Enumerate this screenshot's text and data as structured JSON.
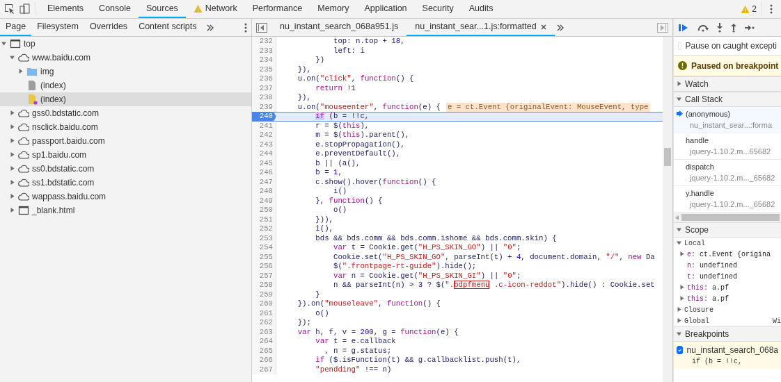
{
  "toolbar": {
    "tabs": [
      {
        "label": "Elements",
        "selected": false,
        "warning": false
      },
      {
        "label": "Console",
        "selected": false,
        "warning": false
      },
      {
        "label": "Sources",
        "selected": true,
        "warning": false
      },
      {
        "label": "Network",
        "selected": false,
        "warning": true
      },
      {
        "label": "Performance",
        "selected": false,
        "warning": false
      },
      {
        "label": "Memory",
        "selected": false,
        "warning": false
      },
      {
        "label": "Application",
        "selected": false,
        "warning": false
      },
      {
        "label": "Security",
        "selected": false,
        "warning": false
      },
      {
        "label": "Audits",
        "selected": false,
        "warning": false
      }
    ],
    "warning_count": "2"
  },
  "navigator": {
    "tabs": [
      {
        "label": "Page",
        "selected": true
      },
      {
        "label": "Filesystem",
        "selected": false
      },
      {
        "label": "Overrides",
        "selected": false
      },
      {
        "label": "Content scripts",
        "selected": false
      }
    ],
    "tree": [
      {
        "label": "top",
        "kind": "frame",
        "expanded": true,
        "selected": false,
        "children": [
          {
            "label": "www.baidu.com",
            "kind": "domain",
            "expanded": true,
            "selected": false,
            "children": [
              {
                "label": "img",
                "kind": "folder",
                "expanded": false,
                "selected": false
              },
              {
                "label": "(index)",
                "kind": "file",
                "selected": false
              },
              {
                "label": "(index)",
                "kind": "script",
                "selected": true
              }
            ]
          },
          {
            "label": "gss0.bdstatic.com",
            "kind": "domain",
            "expanded": false,
            "selected": false
          },
          {
            "label": "nsclick.baidu.com",
            "kind": "domain",
            "expanded": false,
            "selected": false
          },
          {
            "label": "passport.baidu.com",
            "kind": "domain",
            "expanded": false,
            "selected": false
          },
          {
            "label": "sp1.baidu.com",
            "kind": "domain",
            "expanded": false,
            "selected": false
          },
          {
            "label": "ss0.bdstatic.com",
            "kind": "domain",
            "expanded": false,
            "selected": false
          },
          {
            "label": "ss1.bdstatic.com",
            "kind": "domain",
            "expanded": false,
            "selected": false
          },
          {
            "label": "wappass.baidu.com",
            "kind": "domain",
            "expanded": false,
            "selected": false
          },
          {
            "label": "_blank.html",
            "kind": "frame",
            "expanded": false,
            "selected": false
          }
        ]
      }
    ]
  },
  "editor": {
    "tabs": [
      {
        "label": "nu_instant_search_068a951.js",
        "selected": false,
        "closable": false
      },
      {
        "label": "nu_instant_sear...1.js:formatted",
        "selected": true,
        "closable": true
      }
    ],
    "lines": [
      {
        "number": "232",
        "segments": [
          {
            "kind": "txt",
            "text": "            top: n.top + "
          },
          {
            "kind": "num",
            "text": "18"
          },
          {
            "kind": "txt",
            "text": ","
          }
        ]
      },
      {
        "number": "233",
        "segments": [
          {
            "kind": "txt",
            "text": "            left: i"
          }
        ]
      },
      {
        "number": "234",
        "segments": [
          {
            "kind": "txt",
            "text": "        })"
          }
        ]
      },
      {
        "number": "235",
        "segments": [
          {
            "kind": "txt",
            "text": "    }),"
          }
        ]
      },
      {
        "number": "236",
        "segments": [
          {
            "kind": "txt",
            "text": "    u.on("
          },
          {
            "kind": "str",
            "text": "\"click\""
          },
          {
            "kind": "txt",
            "text": ", "
          },
          {
            "kind": "kw",
            "text": "function"
          },
          {
            "kind": "txt",
            "text": "() {"
          }
        ]
      },
      {
        "number": "237",
        "segments": [
          {
            "kind": "kw",
            "text": "        return"
          },
          {
            "kind": "txt",
            "text": " !1"
          }
        ]
      },
      {
        "number": "238",
        "segments": [
          {
            "kind": "txt",
            "text": "    }),"
          }
        ]
      },
      {
        "number": "239",
        "segments": [
          {
            "kind": "txt",
            "text": "    u.on("
          },
          {
            "kind": "str",
            "text": "\"mouseenter\""
          },
          {
            "kind": "txt",
            "text": ", "
          },
          {
            "kind": "kw",
            "text": "function"
          },
          {
            "kind": "txt",
            "text": "(e) {"
          }
        ],
        "inline_value": "e = ct.Event {originalEvent: MouseEvent, type"
      },
      {
        "number": "240",
        "breakpoint": true,
        "current": true,
        "segments": [
          {
            "kind": "hl",
            "text": "if"
          },
          {
            "kind": "txt",
            "text": " (b = !!c,"
          }
        ]
      },
      {
        "number": "241",
        "segments": [
          {
            "kind": "txt",
            "text": "        r = $("
          },
          {
            "kind": "kw",
            "text": "this"
          },
          {
            "kind": "txt",
            "text": "),"
          }
        ]
      },
      {
        "number": "242",
        "segments": [
          {
            "kind": "txt",
            "text": "        m = $("
          },
          {
            "kind": "kw",
            "text": "this"
          },
          {
            "kind": "txt",
            "text": ").parent(),"
          }
        ]
      },
      {
        "number": "243",
        "segments": [
          {
            "kind": "txt",
            "text": "        e.stopPropagation(),"
          }
        ]
      },
      {
        "number": "244",
        "segments": [
          {
            "kind": "txt",
            "text": "        e.preventDefault(),"
          }
        ]
      },
      {
        "number": "245",
        "segments": [
          {
            "kind": "txt",
            "text": "        b || (a(),"
          }
        ]
      },
      {
        "number": "246",
        "segments": [
          {
            "kind": "txt",
            "text": "        b = "
          },
          {
            "kind": "num",
            "text": "1"
          },
          {
            "kind": "txt",
            "text": ","
          }
        ]
      },
      {
        "number": "247",
        "segments": [
          {
            "kind": "txt",
            "text": "        c.show().hover("
          },
          {
            "kind": "kw",
            "text": "function"
          },
          {
            "kind": "txt",
            "text": "() {"
          }
        ]
      },
      {
        "number": "248",
        "segments": [
          {
            "kind": "txt",
            "text": "            i()"
          }
        ]
      },
      {
        "number": "249",
        "segments": [
          {
            "kind": "txt",
            "text": "        }, "
          },
          {
            "kind": "kw",
            "text": "function"
          },
          {
            "kind": "txt",
            "text": "() {"
          }
        ]
      },
      {
        "number": "250",
        "segments": [
          {
            "kind": "txt",
            "text": "            o()"
          }
        ]
      },
      {
        "number": "251",
        "segments": [
          {
            "kind": "txt",
            "text": "        })),"
          }
        ]
      },
      {
        "number": "252",
        "segments": [
          {
            "kind": "txt",
            "text": "        i(),"
          }
        ]
      },
      {
        "number": "253",
        "segments": [
          {
            "kind": "txt",
            "text": "        bds && bds.comm && bds.comm.ishome && bds.comm.skin) {"
          }
        ]
      },
      {
        "number": "254",
        "segments": [
          {
            "kind": "kw",
            "text": "            var"
          },
          {
            "kind": "txt",
            "text": " t = Cookie.get("
          },
          {
            "kind": "str",
            "text": "\"H_PS_SKIN_GO\""
          },
          {
            "kind": "txt",
            "text": ") || "
          },
          {
            "kind": "str",
            "text": "\"0\""
          },
          {
            "kind": "txt",
            "text": ";"
          }
        ]
      },
      {
        "number": "255",
        "segments": [
          {
            "kind": "txt",
            "text": "            Cookie.set("
          },
          {
            "kind": "str",
            "text": "\"H_PS_SKIN_GO\""
          },
          {
            "kind": "txt",
            "text": ", parseInt(t) + "
          },
          {
            "kind": "num",
            "text": "4"
          },
          {
            "kind": "txt",
            "text": ", document.domain, "
          },
          {
            "kind": "str",
            "text": "\"/\""
          },
          {
            "kind": "txt",
            "text": ", "
          },
          {
            "kind": "kw",
            "text": "new"
          },
          {
            "kind": "txt",
            "text": " Da"
          }
        ]
      },
      {
        "number": "256",
        "segments": [
          {
            "kind": "txt",
            "text": "            $("
          },
          {
            "kind": "str",
            "text": "\".frontpage-rt-guide\""
          },
          {
            "kind": "txt",
            "text": ").hide();"
          }
        ]
      },
      {
        "number": "257",
        "segments": [
          {
            "kind": "kw",
            "text": "            var"
          },
          {
            "kind": "txt",
            "text": " n = Cookie.get("
          },
          {
            "kind": "str",
            "text": "\"H_PS_SKIN_GI\""
          },
          {
            "kind": "txt",
            "text": ") || "
          },
          {
            "kind": "str",
            "text": "\"0\""
          },
          {
            "kind": "txt",
            "text": ";"
          }
        ]
      },
      {
        "number": "258",
        "segments": [
          {
            "kind": "txt",
            "text": "            n && parseInt(n) > "
          },
          {
            "kind": "num",
            "text": "3"
          },
          {
            "kind": "txt",
            "text": " ? $("
          },
          {
            "kind": "str",
            "text": "\"."
          },
          {
            "kind": "box",
            "text": "bdpfmenu"
          },
          {
            "kind": "str",
            "text": " .c-icon-reddot\""
          },
          {
            "kind": "txt",
            "text": ").hide() : Cookie.set"
          }
        ]
      },
      {
        "number": "259",
        "segments": [
          {
            "kind": "txt",
            "text": "        }"
          }
        ]
      },
      {
        "number": "260",
        "segments": [
          {
            "kind": "txt",
            "text": "    }).on("
          },
          {
            "kind": "str",
            "text": "\"mouseleave\""
          },
          {
            "kind": "txt",
            "text": ", "
          },
          {
            "kind": "kw",
            "text": "function"
          },
          {
            "kind": "txt",
            "text": "() {"
          }
        ]
      },
      {
        "number": "261",
        "segments": [
          {
            "kind": "txt",
            "text": "        o()"
          }
        ]
      },
      {
        "number": "262",
        "segments": [
          {
            "kind": "txt",
            "text": "    });"
          }
        ]
      },
      {
        "number": "263",
        "segments": [
          {
            "kind": "kw",
            "text": "    var"
          },
          {
            "kind": "txt",
            "text": " h, f, v = "
          },
          {
            "kind": "num",
            "text": "200"
          },
          {
            "kind": "txt",
            "text": ", g = "
          },
          {
            "kind": "kw",
            "text": "function"
          },
          {
            "kind": "txt",
            "text": "(e) {"
          }
        ]
      },
      {
        "number": "264",
        "segments": [
          {
            "kind": "kw",
            "text": "        var"
          },
          {
            "kind": "txt",
            "text": " t = e.callback"
          }
        ]
      },
      {
        "number": "265",
        "segments": [
          {
            "kind": "txt",
            "text": "          , n = g.status;"
          }
        ]
      },
      {
        "number": "266",
        "segments": [
          {
            "kind": "kw",
            "text": "        if"
          },
          {
            "kind": "txt",
            "text": " ($.isFunction(t) && g.callbacklist.push(t),"
          }
        ]
      },
      {
        "number": "267",
        "segments": [
          {
            "kind": "str",
            "text": "        \"pendding\""
          },
          {
            "kind": "txt",
            "text": " !== n)"
          }
        ]
      }
    ]
  },
  "debugger": {
    "pause_on_caught": {
      "label": "Pause on caught excepti",
      "checked": false
    },
    "status": "Paused on breakpoint",
    "watch": {
      "label": "Watch",
      "expanded": false
    },
    "call_stack": {
      "label": "Call Stack",
      "expanded": true,
      "frames": [
        {
          "name": "(anonymous)",
          "location": "nu_instant_sear...:forma",
          "selected": true
        },
        {
          "name": "handle",
          "location": "jquery-1.10.2.m...65682",
          "selected": false
        },
        {
          "name": "dispatch",
          "location": "jquery-1.10.2.m..._65682",
          "selected": false
        },
        {
          "name": "y.handle",
          "location": "jquery-1.10.2.m..._65682",
          "selected": false
        }
      ]
    },
    "scope": {
      "label": "Scope",
      "expanded": true,
      "groups": [
        {
          "label": "Local",
          "expanded": true,
          "vars": [
            {
              "name": "e:",
              "value": "ct.Event {origina",
              "expandable": true
            },
            {
              "name": "n:",
              "value": "undefined",
              "expandable": false
            },
            {
              "name": "t:",
              "value": "undefined",
              "expandable": false
            },
            {
              "name": "this:",
              "value": "a.pf",
              "expandable": true
            },
            {
              "name": "this:",
              "value": "a.pf",
              "expandable": true
            }
          ]
        },
        {
          "label": "Closure",
          "expanded": false
        },
        {
          "label": "Global",
          "expanded": false,
          "value": "Wi"
        }
      ]
    },
    "breakpoints": {
      "label": "Breakpoints",
      "expanded": true,
      "items": [
        {
          "file": "nu_instant_search_068a",
          "code": "if (b = !!c,",
          "checked": true
        }
      ]
    }
  }
}
